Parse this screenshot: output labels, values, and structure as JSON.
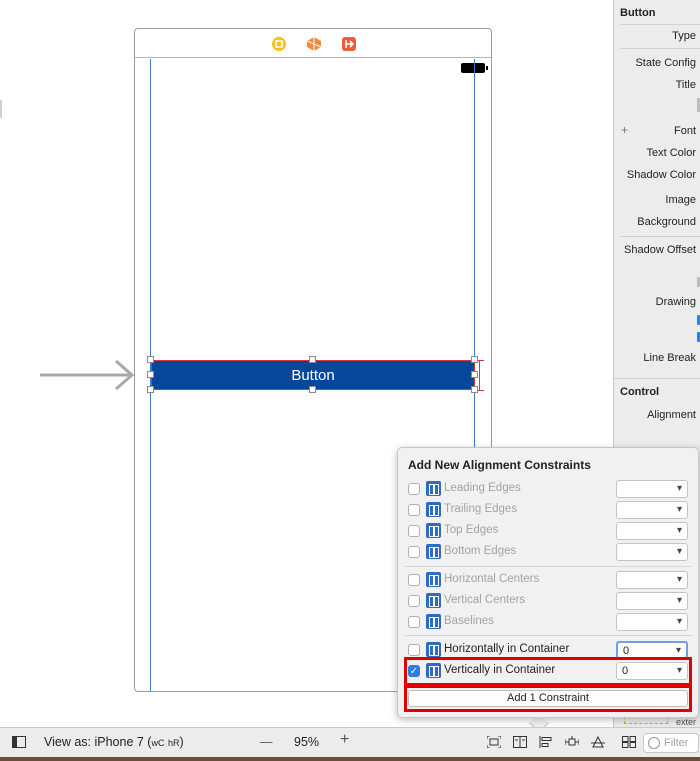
{
  "scene": {
    "button_label": "Button"
  },
  "inspector": {
    "section_button": "Button",
    "labels": [
      "Type",
      "State Config",
      "Title",
      "Font",
      "Text Color",
      "Shadow Color",
      "Image",
      "Background",
      "Shadow Offset",
      "Drawing",
      "Line Break"
    ],
    "section_control": "Control",
    "alignment_label": "Alignment",
    "truncated_text": "exter"
  },
  "popover": {
    "title": "Add New Alignment Constraints",
    "rows": [
      {
        "label": "Leading Edges",
        "checked": false,
        "enabled": false,
        "value": ""
      },
      {
        "label": "Trailing Edges",
        "checked": false,
        "enabled": false,
        "value": ""
      },
      {
        "label": "Top Edges",
        "checked": false,
        "enabled": false,
        "value": ""
      },
      {
        "label": "Bottom Edges",
        "checked": false,
        "enabled": false,
        "value": ""
      },
      {
        "label": "Horizontal Centers",
        "checked": false,
        "enabled": false,
        "value": ""
      },
      {
        "label": "Vertical Centers",
        "checked": false,
        "enabled": false,
        "value": ""
      },
      {
        "label": "Baselines",
        "checked": false,
        "enabled": false,
        "value": ""
      },
      {
        "label": "Horizontally in Container",
        "checked": false,
        "enabled": true,
        "value": "0"
      },
      {
        "label": "Vertically in Container",
        "checked": true,
        "enabled": true,
        "value": "0"
      }
    ],
    "add_button": "Add 1 Constraint"
  },
  "bottombar": {
    "view_as": "View as: iPhone 7 (",
    "size_class_w": "wC",
    "size_class_h": "hR",
    "view_as_end": ")",
    "zoom_out": "—",
    "zoom_level": "95%",
    "zoom_in": "+",
    "filter_placeholder": "Filter"
  },
  "colors": {
    "accent": "#2f7de1",
    "button_fill": "#05479b",
    "highlight": "#e00000",
    "guide": "#3f79c8"
  }
}
